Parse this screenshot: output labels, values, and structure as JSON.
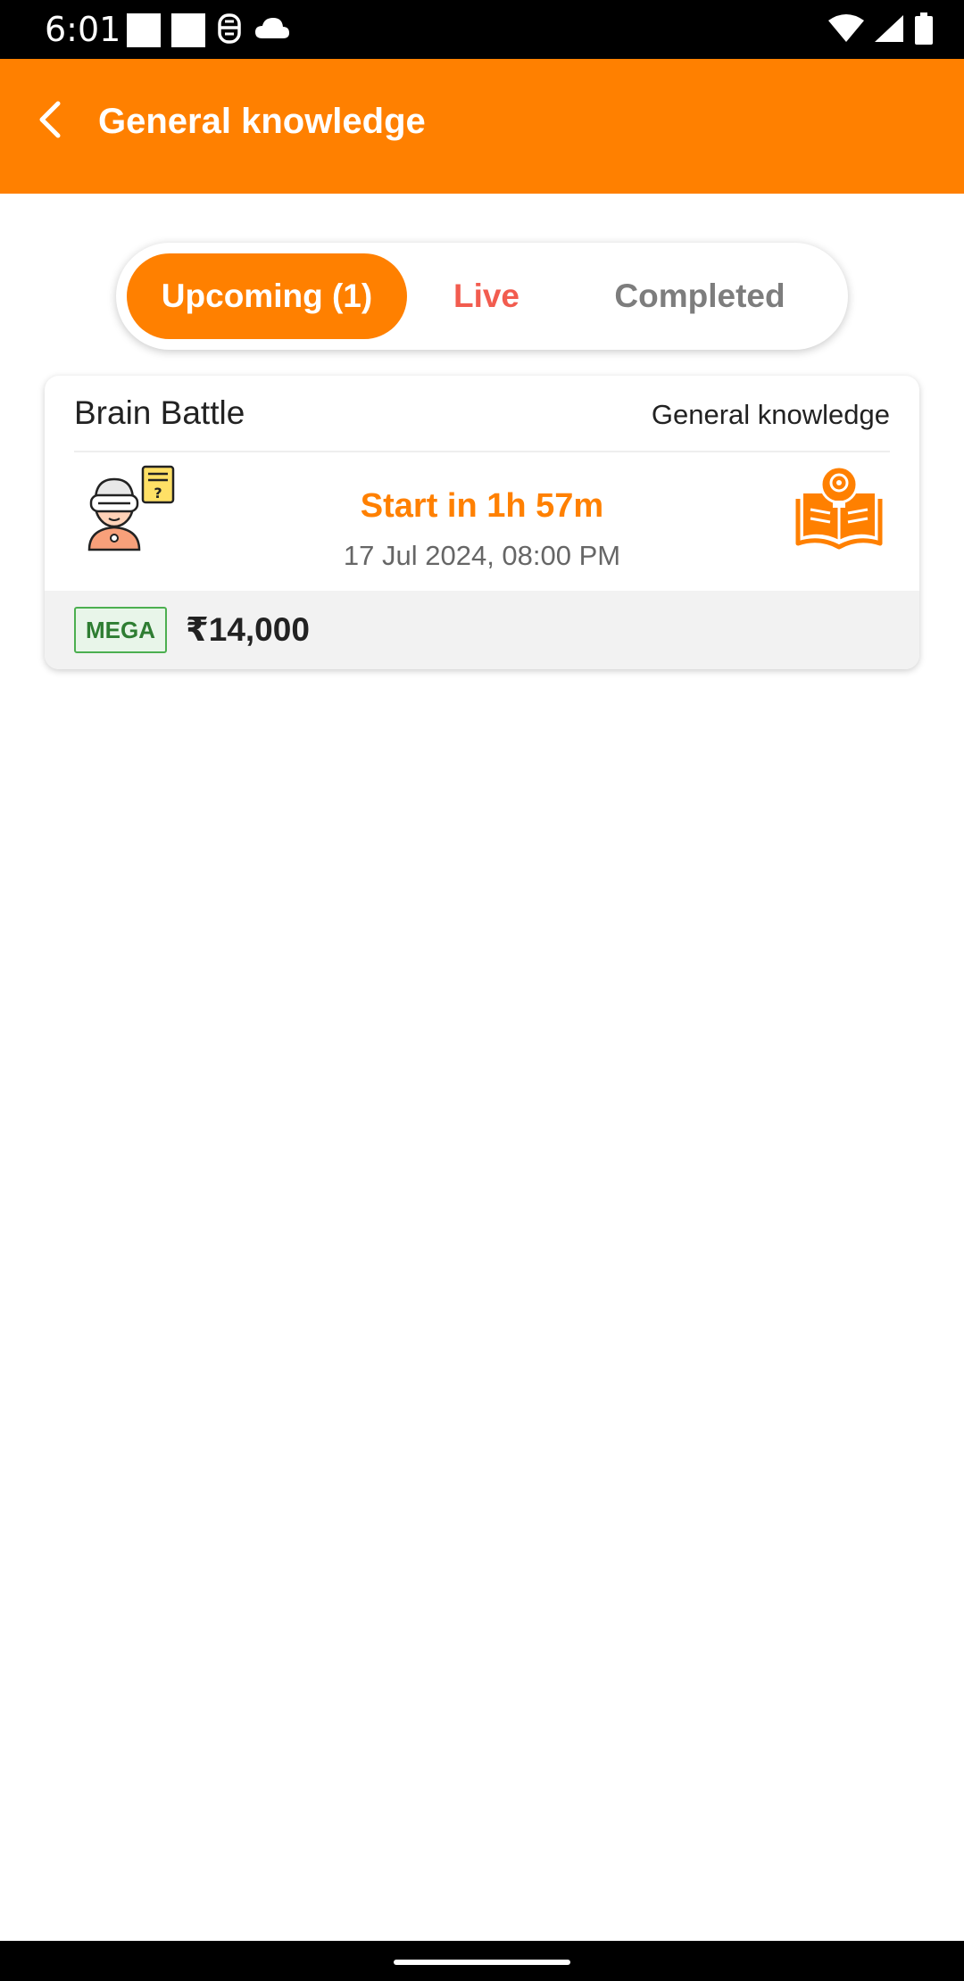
{
  "status_bar": {
    "time": "6:01",
    "icons_left": [
      "notification-square-icon",
      "notification-square-icon",
      "vpn-icon",
      "cloud-icon"
    ],
    "icons_right": [
      "wifi-icon",
      "cellular-signal-icon",
      "battery-icon"
    ]
  },
  "app_bar": {
    "back_icon": "chevron-left-icon",
    "title": "General knowledge"
  },
  "tabs": [
    {
      "label": "Upcoming (1)",
      "active": true
    },
    {
      "label": "Live",
      "active": false
    },
    {
      "label": "Completed",
      "active": false
    }
  ],
  "colors": {
    "accent": "#ff8000",
    "live": "#f25c4f",
    "inactive_tab": "#7d7d7d",
    "mega_green": "#2e7d32"
  },
  "contest_card": {
    "title": "Brain Battle",
    "category": "General knowledge",
    "start_text": "Start in 1h 57m",
    "date_text": "17 Jul 2024, 08:00 PM",
    "badge": "MEGA",
    "prize": "₹14,000",
    "left_icon": "vr-quiz-person-icon",
    "right_icon": "knowledge-book-icon"
  }
}
